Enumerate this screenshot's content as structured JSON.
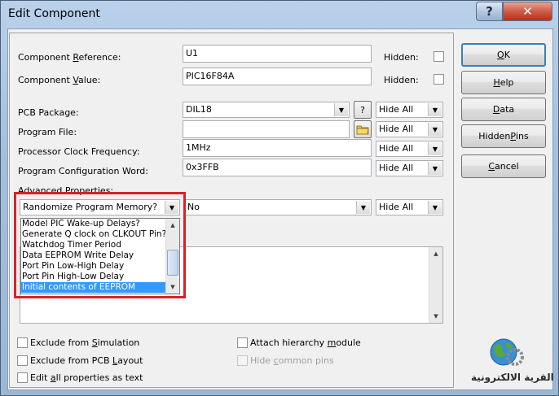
{
  "window": {
    "title": "Edit Component",
    "help_btn": "?",
    "close_btn": "✕"
  },
  "fields": {
    "component_reference": {
      "label_pre": "Component ",
      "label_ul": "R",
      "label_post": "eference:",
      "value": "U1",
      "hidden_label": "Hidden:"
    },
    "component_value": {
      "label_pre": "Component ",
      "label_ul": "V",
      "label_post": "alue:",
      "value": "PIC16F84A",
      "hidden_label": "Hidden:"
    },
    "pcb_package": {
      "label": "PCB Package:",
      "value": "DIL18",
      "query_btn": "?",
      "visibility": "Hide All"
    },
    "program_file": {
      "label": "Program File:",
      "value": "",
      "visibility": "Hide All"
    },
    "clock_frequency": {
      "label": "Processor Clock Frequency:",
      "value": "1MHz",
      "visibility": "Hide All"
    },
    "config_word": {
      "label": "Program Configuration Word:",
      "value": "0x3FFB",
      "visibility": "Hide All"
    }
  },
  "advanced": {
    "label": "Advanced Properties:",
    "selected_property": "Randomize Program Memory?",
    "value": "No",
    "visibility": "Hide All",
    "dropdown_items": [
      "Model PIC Wake-up Delays?",
      "Generate Q clock on CLKOUT Pin?",
      "Watchdog Timer Period",
      "Data EEPROM Write Delay",
      "Port Pin Low-High Delay",
      "Port Pin High-Low Delay",
      "Initial contents of EEPROM"
    ],
    "selected_index": 6
  },
  "options": {
    "exclude_simulation": {
      "pre": "Exclude from ",
      "ul": "S",
      "post": "imulation"
    },
    "exclude_pcb": {
      "pre": "Exclude from PCB ",
      "ul": "L",
      "post": "ayout"
    },
    "edit_all": {
      "pre": "Edit ",
      "ul": "a",
      "post": "ll properties as text"
    },
    "attach_hierarchy": {
      "pre": "Attach hierarchy ",
      "ul": "m",
      "post": "odule"
    },
    "hide_common_pins": {
      "pre": "Hide ",
      "ul": "c",
      "post": "ommon pins"
    }
  },
  "buttons": {
    "ok": {
      "ul": "O",
      "post": "K"
    },
    "help": {
      "ul": "H",
      "post": "elp"
    },
    "data": {
      "ul": "D",
      "post": "ata"
    },
    "hidden_pins": {
      "pre": "Hidden ",
      "ul": "P",
      "post": "ins"
    },
    "cancel": {
      "ul": "C",
      "post": "ancel"
    }
  },
  "logo": {
    "text": "القرية الالكترونية",
    "colors": {
      "globe": "#3a8fd0",
      "land": "#5aa83a",
      "gear": "#8c8c8c"
    }
  }
}
